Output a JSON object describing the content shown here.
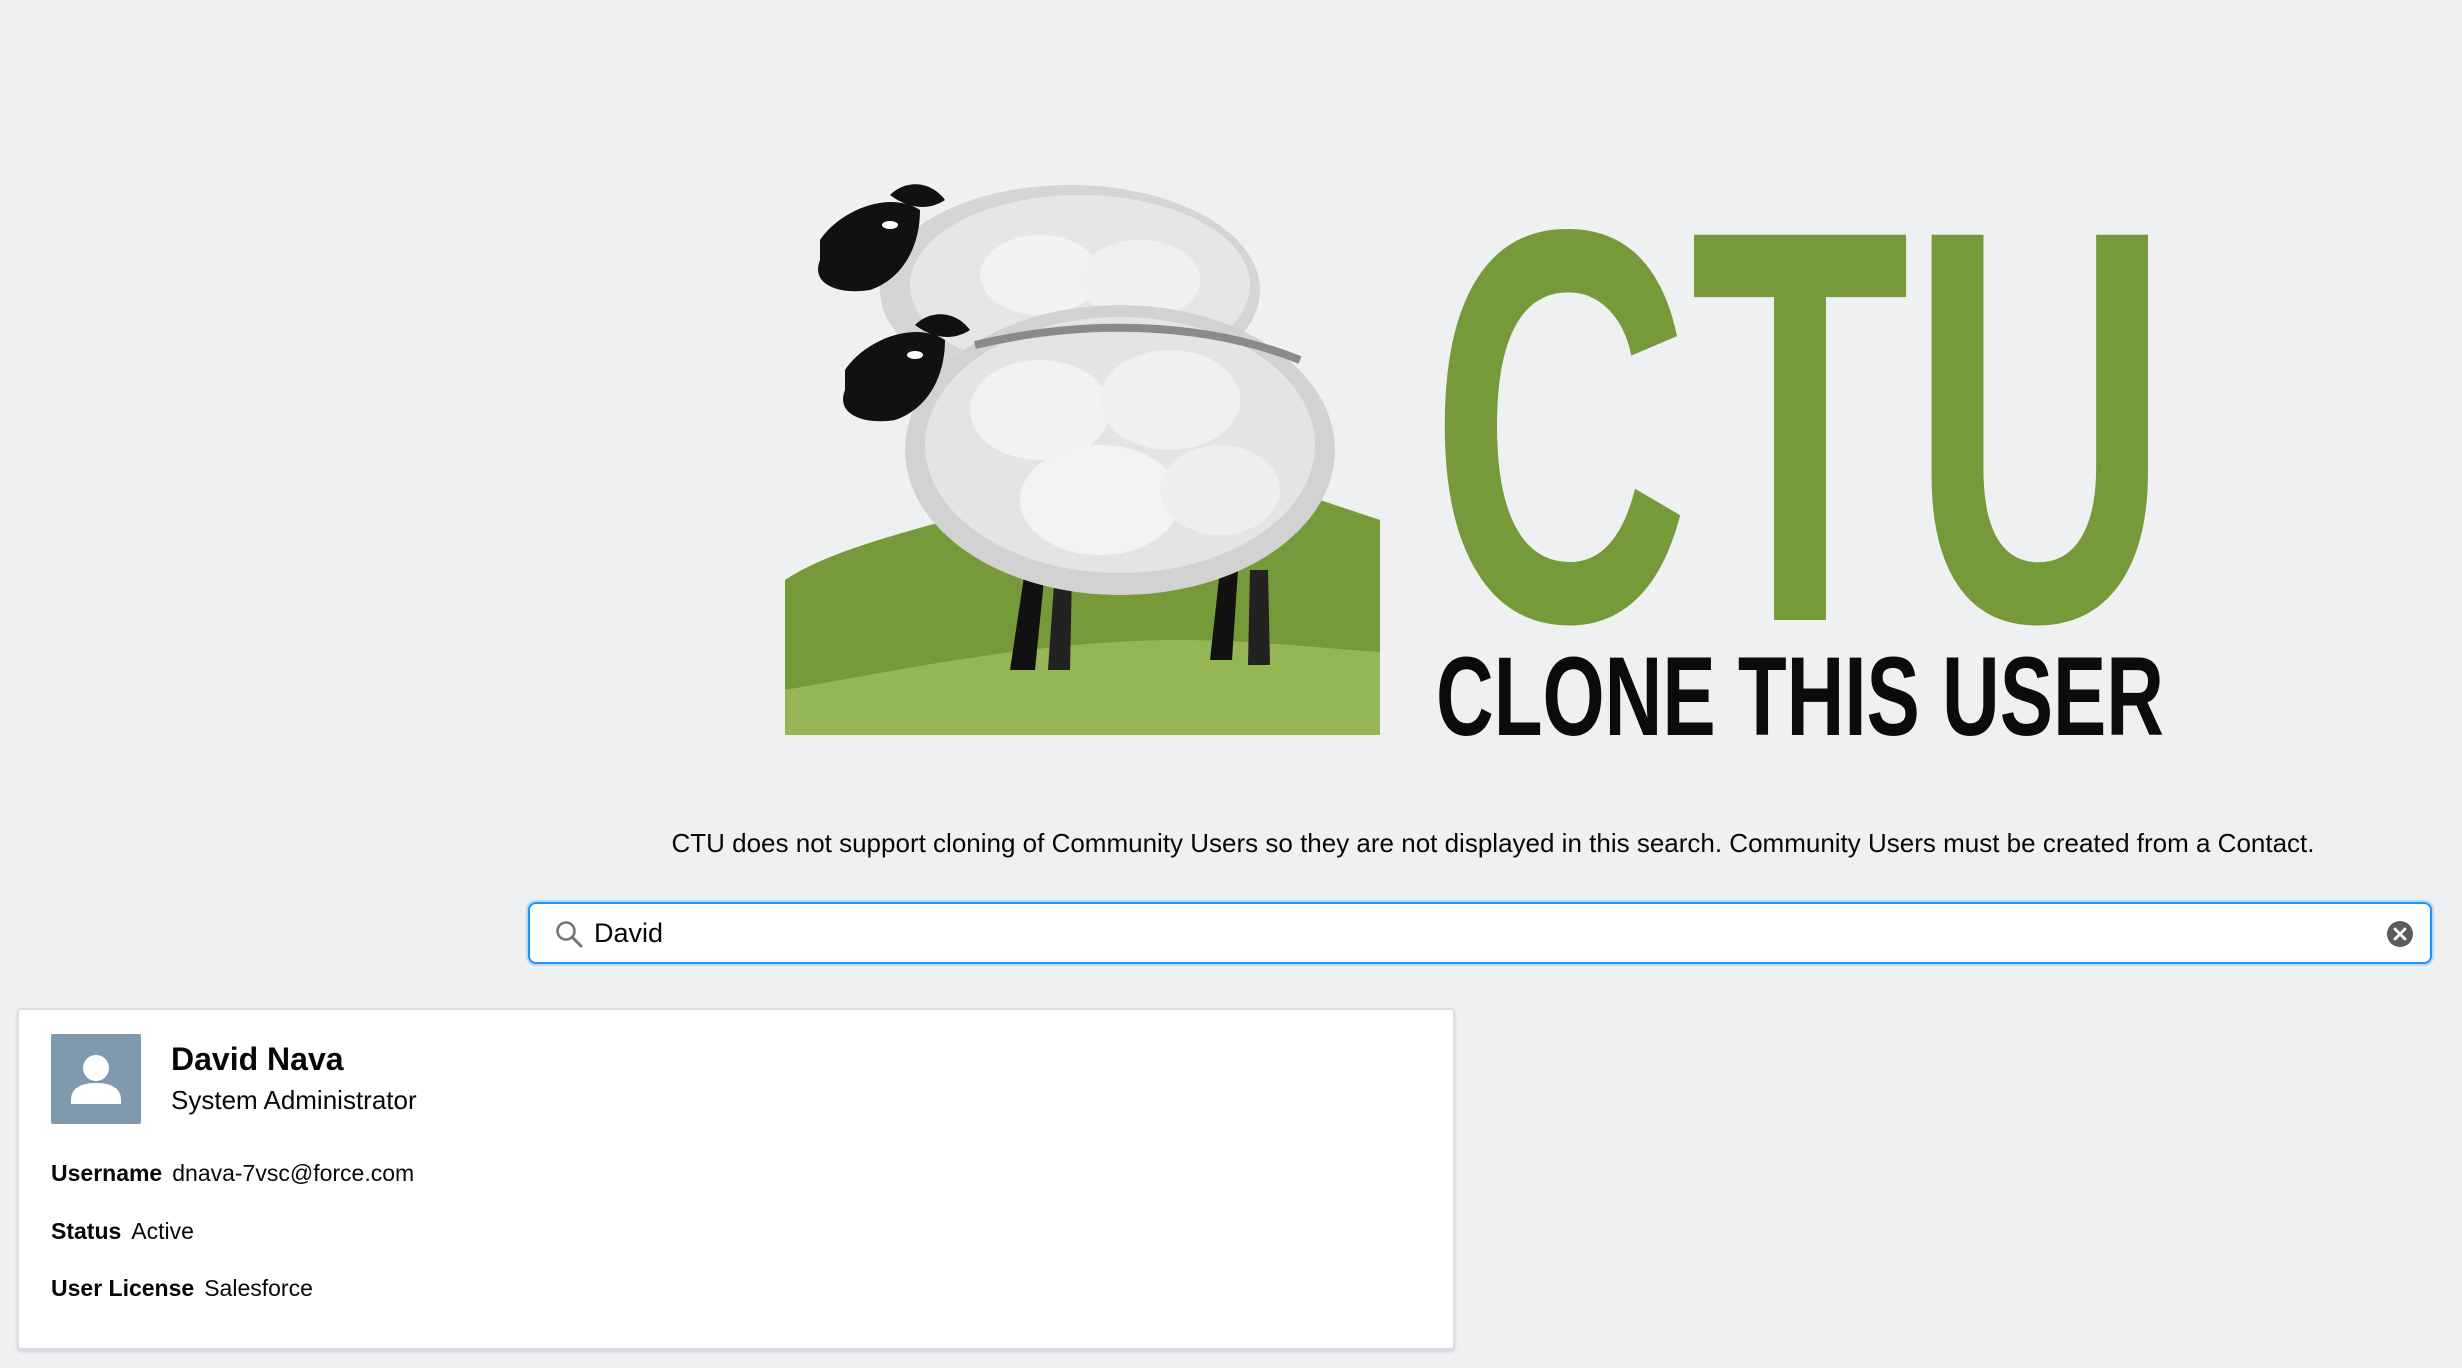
{
  "logo": {
    "text_main": "CTU",
    "text_sub": "CLONE THIS USER",
    "brand_green": "#76993a",
    "hill_light_green": "#94b655",
    "icon": "sheep-logo"
  },
  "notice": "CTU does not support cloning of Community Users so they are not displayed in this search. Community Users must be created from a Contact.",
  "search": {
    "value": "David",
    "icon": "search-icon",
    "clear_icon": "clear-icon",
    "focus_color": "#1b96ff"
  },
  "results": [
    {
      "name": "David Nava",
      "profile": "System Administrator",
      "avatar_icon": "user-avatar-icon",
      "fields": [
        {
          "label": "Username",
          "value": "dnava-7vsc@force.com"
        },
        {
          "label": "Status",
          "value": "Active"
        },
        {
          "label": "User License",
          "value": "Salesforce"
        }
      ]
    }
  ]
}
